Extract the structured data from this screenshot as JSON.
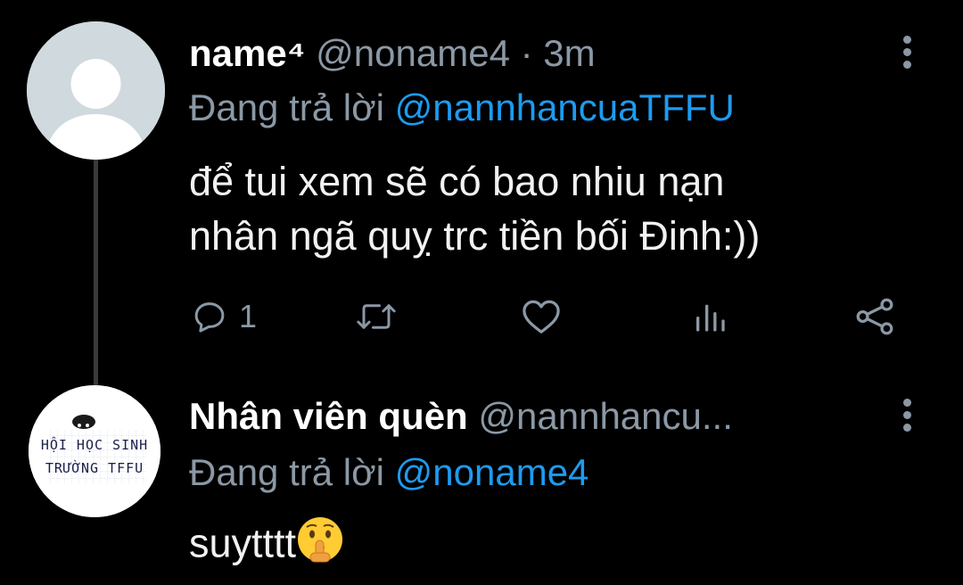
{
  "tweets": [
    {
      "display_name": "name⁴",
      "handle": "@noname4",
      "separator": "·",
      "time": "3m",
      "reply_prefix": "Đang trả lời",
      "reply_to": "@nannhancuaTFFU",
      "text_line1": "để tui xem sẽ có bao nhiu nạn",
      "text_line2": "nhân ngã quỵ trc tiền bối Đinh:))",
      "reply_count": "1",
      "avatar_icon": "default-profile-icon"
    },
    {
      "display_name": "Nhân viên quèn",
      "handle": "@nannhancu...",
      "reply_prefix": "Đang trả lời",
      "reply_to": "@noname4",
      "text": "suytttt",
      "emoji": "shushing-face",
      "avatar_line1": "HỘI HỌC SINH",
      "avatar_line2": "TRƯỜNG TFFU"
    }
  ],
  "colors": {
    "background": "#000000",
    "text": "#e7e9ea",
    "secondary": "#8b98a5",
    "mention": "#1d9bf0",
    "thread_line": "#3a3a3a"
  }
}
